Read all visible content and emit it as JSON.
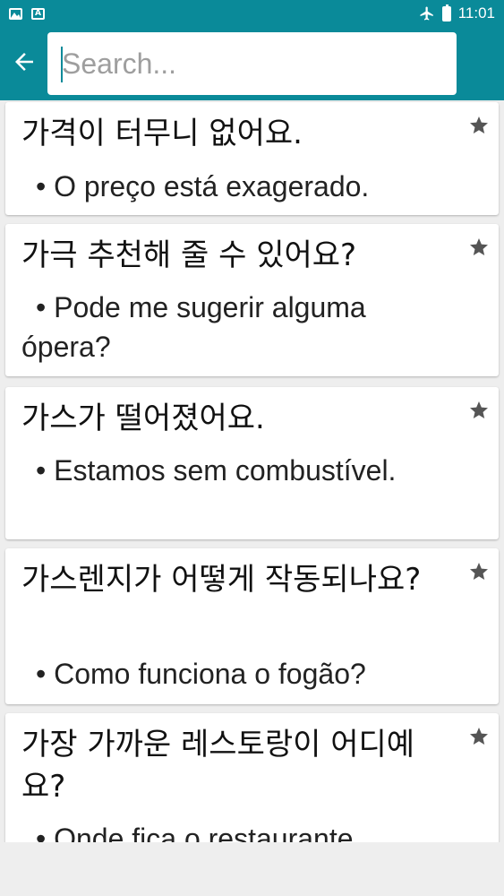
{
  "status_bar": {
    "time": "11:01",
    "left_icons": [
      "image-notification-icon",
      "a-notification-icon"
    ],
    "right_icons": [
      "airplane-mode-icon",
      "battery-icon"
    ],
    "a_icon_label": "A"
  },
  "colors": {
    "primary": "#0a8a99",
    "background": "#eeeeee",
    "card": "#ffffff",
    "star": "#555555"
  },
  "toolbar": {
    "back_icon": "arrow-back-icon",
    "search": {
      "placeholder": "Search...",
      "value": ""
    }
  },
  "phrases": [
    {
      "korean": "가격이 터무니 없어요.",
      "translation": "• O preço está exagerado.",
      "starred": true
    },
    {
      "korean": "가극 추천해 줄 수 있어요?",
      "translation": "• Pode me sugerir alguma ópera?",
      "starred": true
    },
    {
      "korean": "가스가 떨어졌어요.",
      "translation": "• Estamos sem combustível.",
      "starred": true
    },
    {
      "korean": "가스렌지가 어떻게 작동되나요?",
      "translation": "• Como funciona o fogão?",
      "starred": true
    },
    {
      "korean": "가장 가까운 레스토랑이 어디예요?",
      "translation": "• Onde fica o restaurante",
      "starred": true
    }
  ]
}
